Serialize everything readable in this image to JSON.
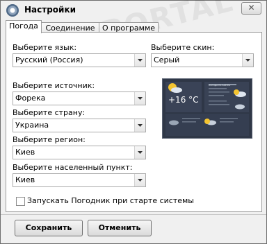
{
  "window": {
    "title": "Настройки",
    "close_symbol": "✕"
  },
  "tabs": [
    {
      "label": "Погода",
      "active": true
    },
    {
      "label": "Соединение",
      "active": false
    },
    {
      "label": "О программе",
      "active": false
    }
  ],
  "form": {
    "language": {
      "label": "Выберите язык:",
      "value": "Русский (Россия)"
    },
    "skin": {
      "label": "Выберите скин:",
      "value": "Серый"
    },
    "source": {
      "label": "Выберите источник:",
      "value": "Форека"
    },
    "country": {
      "label": "Выберите страну:",
      "value": "Украина"
    },
    "region": {
      "label": "Выберите регион:",
      "value": "Киев"
    },
    "city": {
      "label": "Выберите населенный пункт:",
      "value": "Киев"
    },
    "autostart": {
      "label": "Запускать Погодник при старте системы",
      "checked": false
    }
  },
  "preview": {
    "temperature": "+16 °C",
    "header": "ПОГОДА НА ЗАВТРА"
  },
  "buttons": {
    "save": "Сохранить",
    "cancel": "Отменить"
  },
  "watermark": "SOFTPORTAL"
}
